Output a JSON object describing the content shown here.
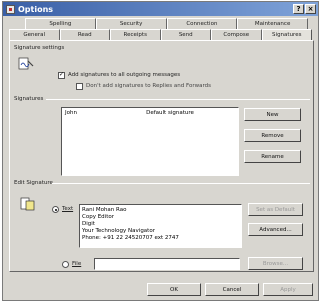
{
  "window": {
    "title": "Options",
    "help_glyph": "?",
    "close_glyph": "×"
  },
  "tabs_row1": [
    "Spelling",
    "Security",
    "Connection",
    "Maintenance"
  ],
  "tabs_row2": [
    "General",
    "Read",
    "Receipts",
    "Send",
    "Compose",
    "Signatures"
  ],
  "signature_settings": {
    "label": "Signature settings",
    "add_to_all": "Add signatures to all outgoing messages",
    "dont_add_replies": "Don't add signatures to Replies and Forwards"
  },
  "signatures": {
    "label": "Signatures",
    "items": [
      {
        "name": "John",
        "note": "Default signature"
      }
    ],
    "new_label": "New",
    "remove_label": "Remove",
    "rename_label": "Rename"
  },
  "edit_signature": {
    "label": "Edit Signature",
    "text_option": "Text",
    "file_option": "File",
    "text_lines": [
      "Rani Mohan Rao",
      "Copy Editor",
      "Digit",
      "Your Technology Navigator",
      "Phone: +91 22 24520707 ext 2747"
    ],
    "set_default_label": "Set as Default",
    "advanced_label": "Advanced...",
    "browse_label": "Browse..."
  },
  "footer": {
    "ok_label": "OK",
    "cancel_label": "Cancel",
    "apply_label": "Apply"
  }
}
